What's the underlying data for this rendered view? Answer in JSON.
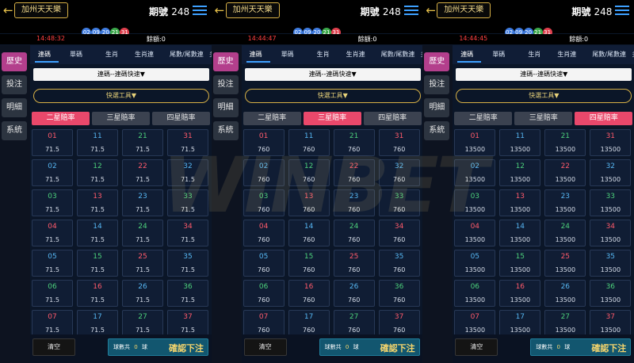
{
  "colors": {
    "red": "#ff5a6b",
    "green": "#4cd07b",
    "blue": "#56b6f2",
    "gold": "#f5d56d",
    "pink_active": "#e9486b",
    "sidebar_active": "#b33f8c"
  },
  "watermark_text": "WINBET",
  "panels": [
    {
      "lottery_name": "加州天天樂",
      "period_label": "期號",
      "period_number": "248",
      "draw_numbers": [
        {
          "num": "02",
          "color": "#3f7ce0"
        },
        {
          "num": "09",
          "color": "#3f7ce0"
        },
        {
          "num": "20",
          "color": "#3f7ce0"
        },
        {
          "num": "21",
          "color": "#3ca94b"
        },
        {
          "num": "31",
          "color": "#e0404e"
        }
      ],
      "time": "14:48:32",
      "balance_label": "餘額:0",
      "sidebar": [
        "歷史",
        "投注",
        "明細",
        "系統"
      ],
      "tabs": [
        "連碼",
        "單碼",
        "生肖",
        "生肖連",
        "尾數/尾數連",
        "多選"
      ],
      "active_tab": 0,
      "select_text": "連碼--連碼快速▼",
      "quick_tools": "快選工具▼",
      "odds_tabs": [
        "二星賠率",
        "三星賠率",
        "四星賠率"
      ],
      "active_odds": 0,
      "cells": [
        {
          "num": "01",
          "odds": "71.5",
          "color": "#ff5a6b"
        },
        {
          "num": "11",
          "odds": "71.5",
          "color": "#56b6f2"
        },
        {
          "num": "21",
          "odds": "71.5",
          "color": "#4cd07b"
        },
        {
          "num": "31",
          "odds": "71.5",
          "color": "#ff5a6b"
        },
        {
          "num": "02",
          "odds": "71.5",
          "color": "#56b6f2"
        },
        {
          "num": "12",
          "odds": "71.5",
          "color": "#4cd07b"
        },
        {
          "num": "22",
          "odds": "71.5",
          "color": "#ff5a6b"
        },
        {
          "num": "32",
          "odds": "71.5",
          "color": "#56b6f2"
        },
        {
          "num": "03",
          "odds": "71.5",
          "color": "#4cd07b"
        },
        {
          "num": "13",
          "odds": "71.5",
          "color": "#ff5a6b"
        },
        {
          "num": "23",
          "odds": "71.5",
          "color": "#56b6f2"
        },
        {
          "num": "33",
          "odds": "71.5",
          "color": "#4cd07b"
        },
        {
          "num": "04",
          "odds": "71.5",
          "color": "#ff5a6b"
        },
        {
          "num": "14",
          "odds": "71.5",
          "color": "#56b6f2"
        },
        {
          "num": "24",
          "odds": "71.5",
          "color": "#4cd07b"
        },
        {
          "num": "34",
          "odds": "71.5",
          "color": "#ff5a6b"
        },
        {
          "num": "05",
          "odds": "71.5",
          "color": "#56b6f2"
        },
        {
          "num": "15",
          "odds": "71.5",
          "color": "#4cd07b"
        },
        {
          "num": "25",
          "odds": "71.5",
          "color": "#ff5a6b"
        },
        {
          "num": "35",
          "odds": "71.5",
          "color": "#56b6f2"
        },
        {
          "num": "06",
          "odds": "71.5",
          "color": "#4cd07b"
        },
        {
          "num": "16",
          "odds": "71.5",
          "color": "#ff5a6b"
        },
        {
          "num": "26",
          "odds": "71.5",
          "color": "#56b6f2"
        },
        {
          "num": "36",
          "odds": "71.5",
          "color": "#4cd07b"
        },
        {
          "num": "07",
          "odds": "71.5",
          "color": "#ff5a6b"
        },
        {
          "num": "17",
          "odds": "71.5",
          "color": "#56b6f2"
        },
        {
          "num": "27",
          "odds": "71.5",
          "color": "#4cd07b"
        },
        {
          "num": "37",
          "odds": "71.5",
          "color": "#ff5a6b"
        }
      ],
      "clear_label": "清空",
      "count_prefix": "球數共",
      "count_value": "0",
      "count_suffix": "球",
      "confirm_label": "確認下注"
    },
    {
      "lottery_name": "加州天天樂",
      "period_label": "期號",
      "period_number": "248",
      "draw_numbers": [
        {
          "num": "02",
          "color": "#3f7ce0"
        },
        {
          "num": "09",
          "color": "#3f7ce0"
        },
        {
          "num": "20",
          "color": "#3f7ce0"
        },
        {
          "num": "21",
          "color": "#3ca94b"
        },
        {
          "num": "31",
          "color": "#e0404e"
        }
      ],
      "time": "14:44:47",
      "balance_label": "餘額:0",
      "sidebar": [
        "歷史",
        "投注",
        "明細",
        "系統"
      ],
      "tabs": [
        "連碼",
        "單碼",
        "生肖",
        "生肖連",
        "尾數/尾數連",
        "多選"
      ],
      "active_tab": 0,
      "select_text": "連碼--連碼快速▼",
      "quick_tools": "快選工具▼",
      "odds_tabs": [
        "二星賠率",
        "三星賠率",
        "四星賠率"
      ],
      "active_odds": 1,
      "cells": [
        {
          "num": "01",
          "odds": "760",
          "color": "#ff5a6b"
        },
        {
          "num": "11",
          "odds": "760",
          "color": "#56b6f2"
        },
        {
          "num": "21",
          "odds": "760",
          "color": "#4cd07b"
        },
        {
          "num": "31",
          "odds": "760",
          "color": "#ff5a6b"
        },
        {
          "num": "02",
          "odds": "760",
          "color": "#56b6f2"
        },
        {
          "num": "12",
          "odds": "760",
          "color": "#4cd07b"
        },
        {
          "num": "22",
          "odds": "760",
          "color": "#ff5a6b"
        },
        {
          "num": "32",
          "odds": "760",
          "color": "#56b6f2"
        },
        {
          "num": "03",
          "odds": "760",
          "color": "#4cd07b"
        },
        {
          "num": "13",
          "odds": "760",
          "color": "#ff5a6b"
        },
        {
          "num": "23",
          "odds": "760",
          "color": "#56b6f2"
        },
        {
          "num": "33",
          "odds": "760",
          "color": "#4cd07b"
        },
        {
          "num": "04",
          "odds": "760",
          "color": "#ff5a6b"
        },
        {
          "num": "14",
          "odds": "760",
          "color": "#56b6f2"
        },
        {
          "num": "24",
          "odds": "760",
          "color": "#4cd07b"
        },
        {
          "num": "34",
          "odds": "760",
          "color": "#ff5a6b"
        },
        {
          "num": "05",
          "odds": "760",
          "color": "#56b6f2"
        },
        {
          "num": "15",
          "odds": "760",
          "color": "#4cd07b"
        },
        {
          "num": "25",
          "odds": "760",
          "color": "#ff5a6b"
        },
        {
          "num": "35",
          "odds": "760",
          "color": "#56b6f2"
        },
        {
          "num": "06",
          "odds": "760",
          "color": "#4cd07b"
        },
        {
          "num": "16",
          "odds": "760",
          "color": "#ff5a6b"
        },
        {
          "num": "26",
          "odds": "760",
          "color": "#56b6f2"
        },
        {
          "num": "36",
          "odds": "760",
          "color": "#4cd07b"
        },
        {
          "num": "07",
          "odds": "760",
          "color": "#ff5a6b"
        },
        {
          "num": "17",
          "odds": "760",
          "color": "#56b6f2"
        },
        {
          "num": "27",
          "odds": "760",
          "color": "#4cd07b"
        },
        {
          "num": "37",
          "odds": "760",
          "color": "#ff5a6b"
        }
      ],
      "clear_label": "清空",
      "count_prefix": "球數共",
      "count_value": "0",
      "count_suffix": "球",
      "confirm_label": "確認下注"
    },
    {
      "lottery_name": "加州天天樂",
      "period_label": "期號",
      "period_number": "248",
      "draw_numbers": [
        {
          "num": "02",
          "color": "#3f7ce0"
        },
        {
          "num": "09",
          "color": "#3f7ce0"
        },
        {
          "num": "20",
          "color": "#3f7ce0"
        },
        {
          "num": "21",
          "color": "#3ca94b"
        },
        {
          "num": "31",
          "color": "#e0404e"
        }
      ],
      "time": "14:44:45",
      "balance_label": "餘額:0",
      "sidebar": [
        "歷史",
        "投注",
        "明細",
        "系統"
      ],
      "tabs": [
        "連碼",
        "單碼",
        "生肖",
        "生肖連",
        "尾數/尾數連",
        "多選"
      ],
      "active_tab": 0,
      "select_text": "連碼--連碼快速▼",
      "quick_tools": "快選工具▼",
      "odds_tabs": [
        "二星賠率",
        "三星賠率",
        "四星賠率"
      ],
      "active_odds": 2,
      "cells": [
        {
          "num": "01",
          "odds": "13500",
          "color": "#ff5a6b"
        },
        {
          "num": "11",
          "odds": "13500",
          "color": "#56b6f2"
        },
        {
          "num": "21",
          "odds": "13500",
          "color": "#4cd07b"
        },
        {
          "num": "31",
          "odds": "13500",
          "color": "#ff5a6b"
        },
        {
          "num": "02",
          "odds": "13500",
          "color": "#56b6f2"
        },
        {
          "num": "12",
          "odds": "13500",
          "color": "#4cd07b"
        },
        {
          "num": "22",
          "odds": "13500",
          "color": "#ff5a6b"
        },
        {
          "num": "32",
          "odds": "13500",
          "color": "#56b6f2"
        },
        {
          "num": "03",
          "odds": "13500",
          "color": "#4cd07b"
        },
        {
          "num": "13",
          "odds": "13500",
          "color": "#ff5a6b"
        },
        {
          "num": "23",
          "odds": "13500",
          "color": "#56b6f2"
        },
        {
          "num": "33",
          "odds": "13500",
          "color": "#4cd07b"
        },
        {
          "num": "04",
          "odds": "13500",
          "color": "#ff5a6b"
        },
        {
          "num": "14",
          "odds": "13500",
          "color": "#56b6f2"
        },
        {
          "num": "24",
          "odds": "13500",
          "color": "#4cd07b"
        },
        {
          "num": "34",
          "odds": "13500",
          "color": "#ff5a6b"
        },
        {
          "num": "05",
          "odds": "13500",
          "color": "#56b6f2"
        },
        {
          "num": "15",
          "odds": "13500",
          "color": "#4cd07b"
        },
        {
          "num": "25",
          "odds": "13500",
          "color": "#ff5a6b"
        },
        {
          "num": "35",
          "odds": "13500",
          "color": "#56b6f2"
        },
        {
          "num": "06",
          "odds": "13500",
          "color": "#4cd07b"
        },
        {
          "num": "16",
          "odds": "13500",
          "color": "#ff5a6b"
        },
        {
          "num": "26",
          "odds": "13500",
          "color": "#56b6f2"
        },
        {
          "num": "36",
          "odds": "13500",
          "color": "#4cd07b"
        },
        {
          "num": "07",
          "odds": "13500",
          "color": "#ff5a6b"
        },
        {
          "num": "17",
          "odds": "13500",
          "color": "#56b6f2"
        },
        {
          "num": "27",
          "odds": "13500",
          "color": "#4cd07b"
        },
        {
          "num": "37",
          "odds": "13500",
          "color": "#ff5a6b"
        }
      ],
      "clear_label": "清空",
      "count_prefix": "球數共",
      "count_value": "0",
      "count_suffix": "球",
      "confirm_label": "確認下注"
    }
  ]
}
